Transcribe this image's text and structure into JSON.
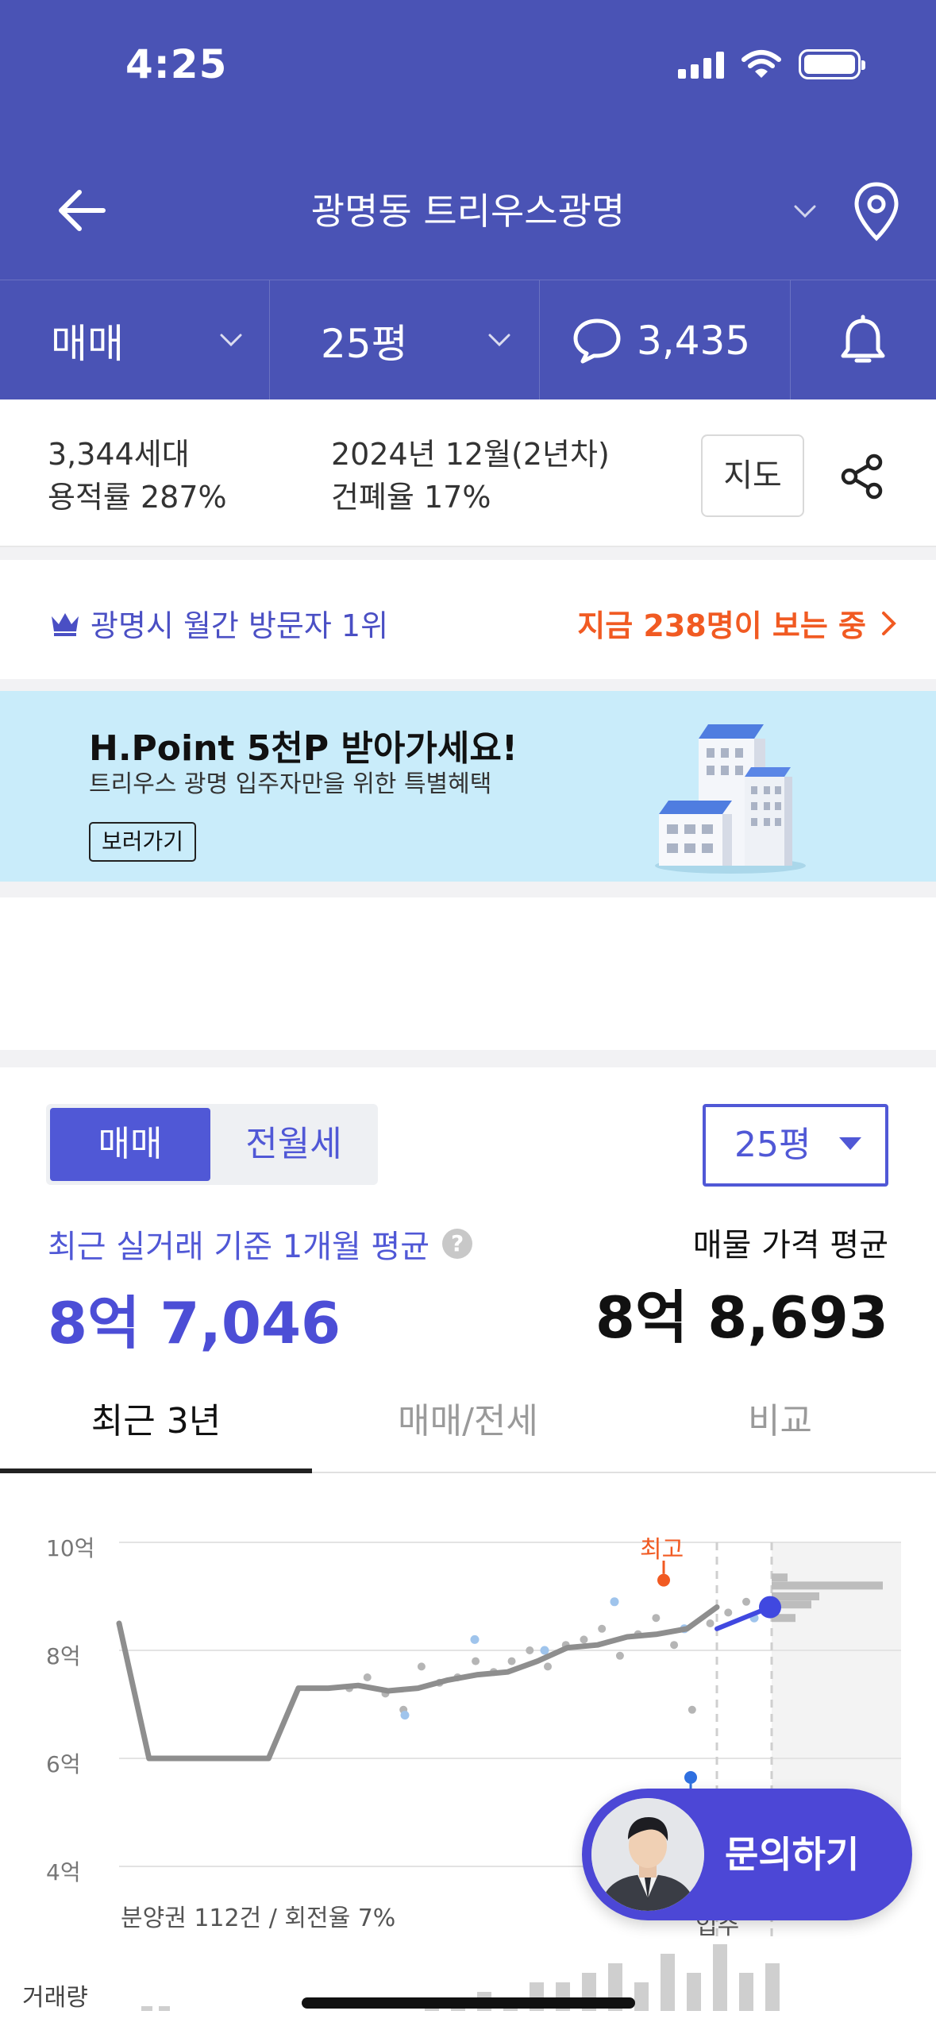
{
  "status_bar": {
    "time": "4:25"
  },
  "header": {
    "title": "광명동 트리우스광명",
    "filters": {
      "trade_type": "매매",
      "area": "25평",
      "comments_count": "3,435"
    }
  },
  "info": {
    "households": "3,344세대",
    "floor_area_ratio": "용적률 287%",
    "completion": "2024년 12월(2년차)",
    "coverage_ratio": "건폐율 17%",
    "map_button": "지도"
  },
  "visitor": {
    "rank_text": "광명시 월간 방문자 1위",
    "viewing_text": "지금 238명이 보는 중"
  },
  "banner": {
    "title": "H.Point 5천P 받아가세요!",
    "subtitle": "트리우스 광명 입주자만을 위한 특별혜택",
    "button": "보러가기"
  },
  "price": {
    "segments": [
      "매매",
      "전월세"
    ],
    "area_select": "25평",
    "avg_label": "최근 실거래 기준 1개월 평균",
    "avg_value": "8억 7,046",
    "listing_label": "매물 가격 평균",
    "listing_value": "8억 8,693"
  },
  "tabs": [
    "최근 3년",
    "매매/전세",
    "비교"
  ],
  "chart": {
    "y_ticks": [
      "10억",
      "8억",
      "6억",
      "4억"
    ],
    "note": "분양권 112건 / 회전율 7%",
    "highest_label": "최고",
    "move_in_label": "입주",
    "volume_label": "거래량"
  },
  "chart_data": {
    "type": "line",
    "title": "",
    "ylabel": "",
    "y_unit": "억",
    "ylim": [
      4,
      10
    ],
    "grid": true,
    "series": [
      {
        "values": [
          8.5,
          6.0,
          6.0,
          6.0,
          6.0,
          6.0,
          7.3,
          7.3,
          7.35,
          7.25,
          7.3,
          7.45,
          7.55,
          7.6,
          7.8,
          8.05,
          8.1,
          8.25,
          8.3,
          8.4,
          8.8
        ]
      }
    ],
    "scatter_gray": [
      7.3,
      7.5,
      7.2,
      6.9,
      7.7,
      7.4,
      7.5,
      7.8,
      7.6,
      7.8,
      8.0,
      7.7,
      8.1,
      8.2,
      8.4,
      7.9,
      8.3,
      8.6,
      8.1,
      6.9,
      8.5,
      8.7,
      8.9
    ],
    "scatter_blue": [
      6.8,
      8.2,
      8.0,
      8.9,
      8.4,
      8.6
    ],
    "highest_value": 9.3,
    "volume_bars": [
      1,
      1,
      2,
      1,
      3,
      3,
      4,
      5,
      3,
      6,
      4,
      7,
      4,
      5
    ]
  },
  "inquiry": {
    "label": "문의하기"
  },
  "colors": {
    "header": "#4a53b5",
    "accent": "#5058d6",
    "highlight": "#f15a22",
    "banner": "#c9ecfa"
  },
  "icons": [
    "back-arrow-icon",
    "chevron-down-icon",
    "location-pin-icon",
    "chat-bubble-icon",
    "bell-icon",
    "share-icon",
    "crown-icon",
    "chevron-right-icon",
    "help-icon"
  ]
}
